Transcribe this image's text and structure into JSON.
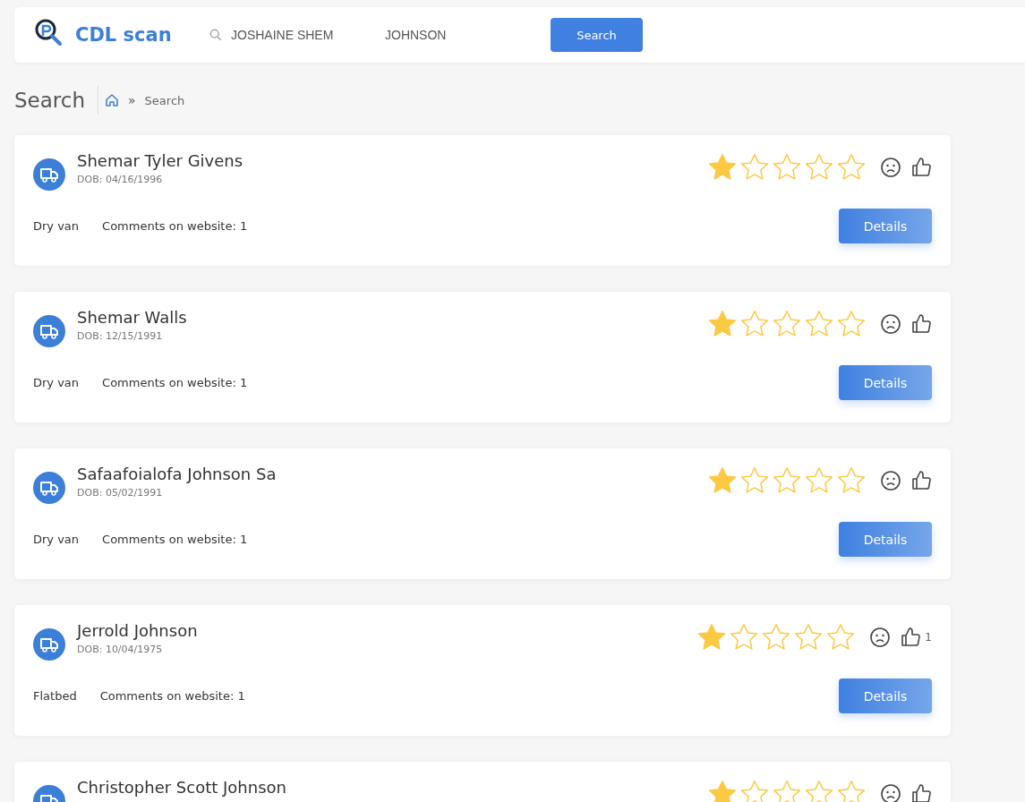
{
  "header": {
    "brand": "CDL scan",
    "search_first": {
      "value": "JOSHAINE SHEM"
    },
    "search_last": {
      "value": "JOHNSON"
    },
    "search_button": "Search"
  },
  "page_title": "Search",
  "breadcrumb": {
    "current": "Search",
    "separator": "»"
  },
  "results": [
    {
      "name": "Shemar Tyler Givens",
      "dob": "DOB: 04/16/1996",
      "type": "Dry van",
      "comments": "Comments on website: 1",
      "stars": 1,
      "button": "Details"
    },
    {
      "name": "Shemar Walls",
      "dob": "DOB: 12/15/1991",
      "type": "Dry van",
      "comments": "Comments on website: 1",
      "stars": 1,
      "button": "Details"
    },
    {
      "name": "Safaafoialofa Johnson Sa",
      "dob": "DOB: 05/02/1991",
      "type": "Dry van",
      "comments": "Comments on website: 1",
      "stars": 1,
      "button": "Details"
    },
    {
      "name": "Jerrold Johnson",
      "dob": "DOB: 10/04/1975",
      "type": "Flatbed",
      "comments": "Comments on website: 1",
      "stars": 1,
      "likes": "1",
      "button": "Details"
    },
    {
      "name": "Christopher Scott Johnson",
      "stars": 1
    }
  ]
}
